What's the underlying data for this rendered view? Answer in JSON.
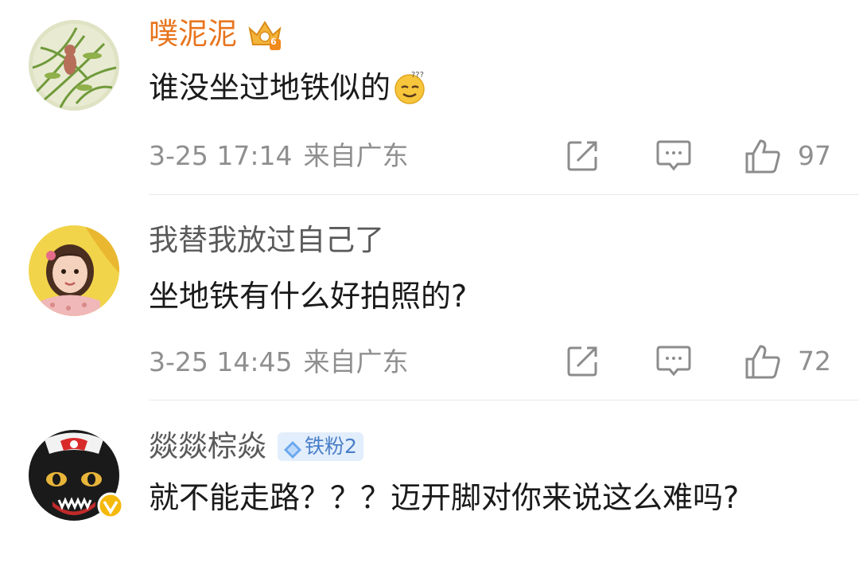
{
  "comments": [
    {
      "username": "噗泥泥",
      "content": "谁没坐过地铁似的",
      "date": "3-25 17:14",
      "location": "来自广东",
      "likes": "97",
      "name_color": "#e8741c",
      "vip_level": "6"
    },
    {
      "username": "我替我放过自己了",
      "content": "坐地铁有什么好拍照的?",
      "date": "3-25 14:45",
      "location": "来自广东",
      "likes": "72",
      "name_color": "#5a5a5a"
    },
    {
      "username": "燚燚棕焱",
      "badge": "铁粉2",
      "content": "就不能走路？？？迈开脚对你来说这么难吗?",
      "name_color": "#5a5a5a"
    }
  ],
  "icons": [
    "share-icon",
    "comment-icon",
    "like-icon",
    "vip-crown-icon",
    "emoji-dizzy-icon",
    "verified-icon",
    "fan-diamond-icon"
  ]
}
